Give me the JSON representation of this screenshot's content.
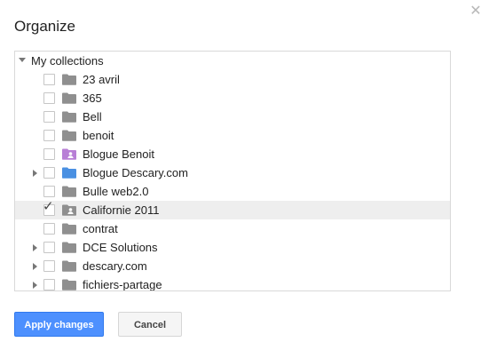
{
  "dialog": {
    "title": "Organize",
    "close_icon": "close-icon",
    "root": {
      "label": "My collections",
      "expanded": true
    },
    "items": [
      {
        "name": "23 avril",
        "checked": false,
        "expandable": false,
        "folder_type": "plain",
        "folder_color": "#8f8f8f"
      },
      {
        "name": "365",
        "checked": false,
        "expandable": false,
        "folder_type": "plain",
        "folder_color": "#8f8f8f"
      },
      {
        "name": "Bell",
        "checked": false,
        "expandable": false,
        "folder_type": "plain",
        "folder_color": "#8f8f8f"
      },
      {
        "name": "benoit",
        "checked": false,
        "expandable": false,
        "folder_type": "plain",
        "folder_color": "#8f8f8f"
      },
      {
        "name": "Blogue Benoit",
        "checked": false,
        "expandable": false,
        "folder_type": "shared",
        "folder_color": "#b87fd6"
      },
      {
        "name": "Blogue Descary.com",
        "checked": false,
        "expandable": true,
        "folder_type": "plain",
        "folder_color": "#4a90e2"
      },
      {
        "name": "Bulle web2.0",
        "checked": false,
        "expandable": false,
        "folder_type": "plain",
        "folder_color": "#8f8f8f"
      },
      {
        "name": "Californie 2011",
        "checked": true,
        "expandable": false,
        "folder_type": "shared",
        "folder_color": "#8f8f8f",
        "selected": true
      },
      {
        "name": "contrat",
        "checked": false,
        "expandable": false,
        "folder_type": "plain",
        "folder_color": "#8f8f8f"
      },
      {
        "name": "DCE Solutions",
        "checked": false,
        "expandable": true,
        "folder_type": "plain",
        "folder_color": "#8f8f8f"
      },
      {
        "name": "descary.com",
        "checked": false,
        "expandable": true,
        "folder_type": "plain",
        "folder_color": "#8f8f8f"
      },
      {
        "name": "fichiers-partage",
        "checked": false,
        "expandable": true,
        "folder_type": "plain",
        "folder_color": "#8f8f8f"
      }
    ],
    "buttons": {
      "apply_label": "Apply changes",
      "cancel_label": "Cancel"
    },
    "colors": {
      "primary": "#4d90fe",
      "selected_row": "#eeeeee"
    }
  }
}
